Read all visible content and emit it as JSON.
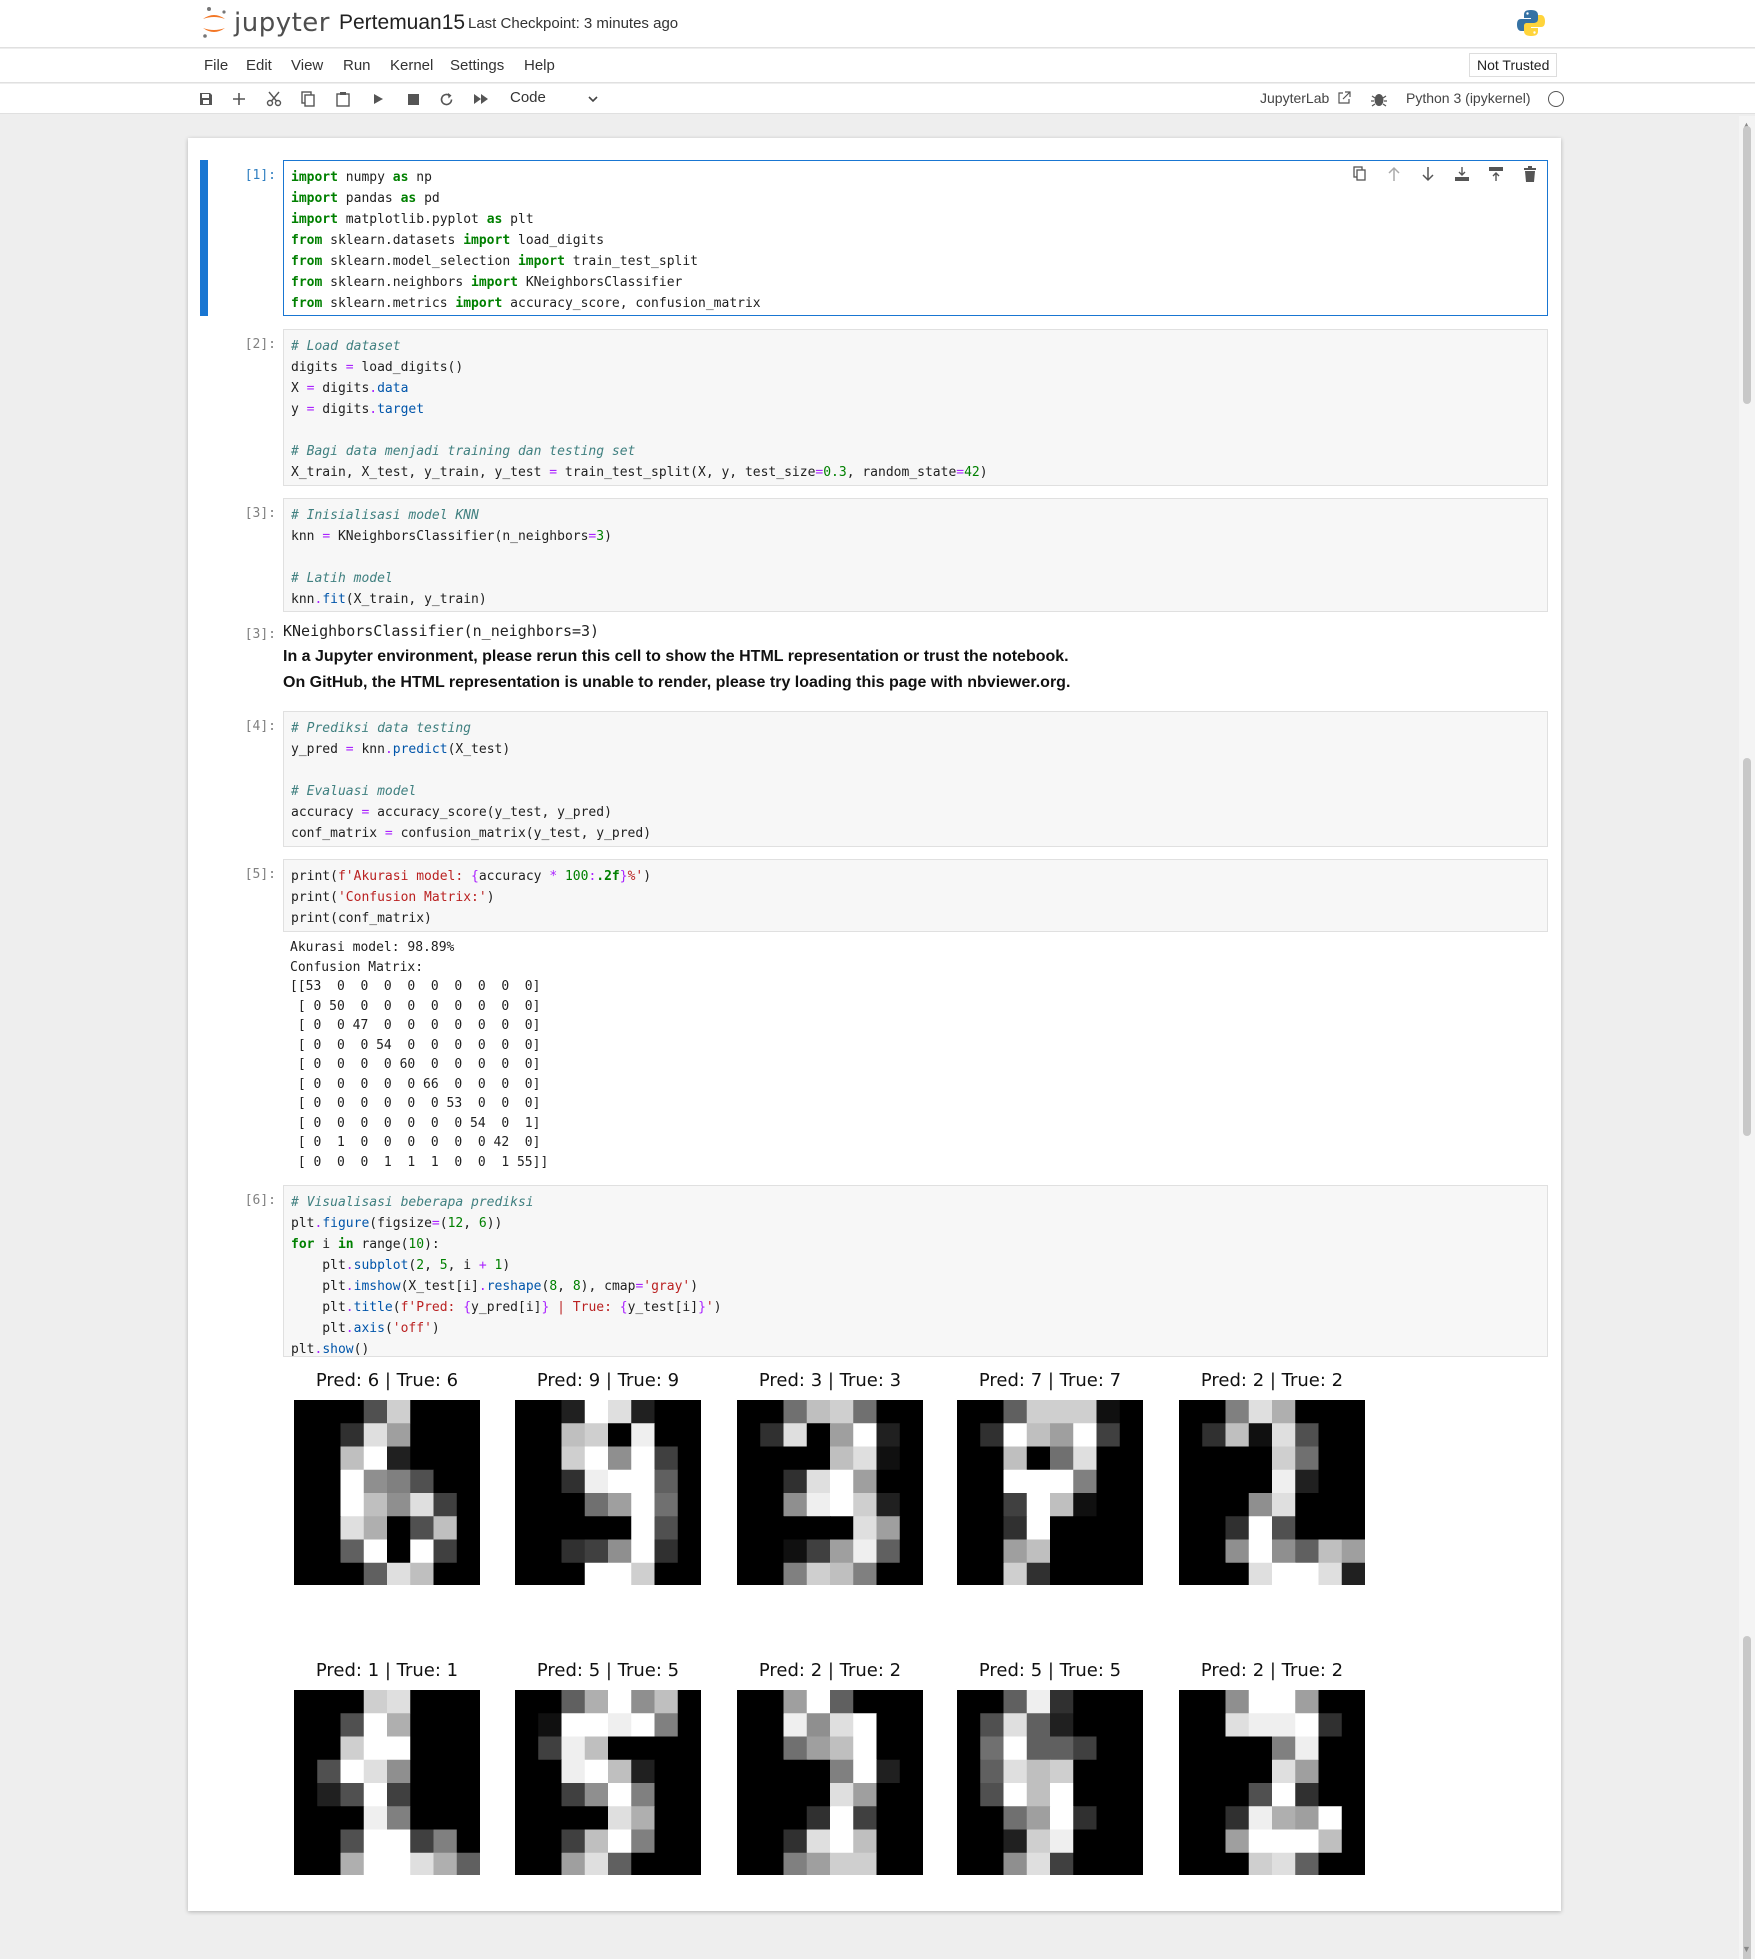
{
  "header": {
    "logo_text": "jupyter",
    "notebook_title": "Pertemuan15",
    "checkpoint": "Last Checkpoint: 3 minutes ago"
  },
  "menu": {
    "items": [
      "File",
      "Edit",
      "View",
      "Run",
      "Kernel",
      "Settings",
      "Help"
    ],
    "trust_status": "Not Trusted"
  },
  "toolbar": {
    "cell_type": "Code",
    "jupyterlab_link": "JupyterLab",
    "kernel": "Python 3 (ipykernel)",
    "icons": [
      "save-icon",
      "add-cell-icon",
      "cut-icon",
      "copy-icon",
      "paste-icon",
      "run-icon",
      "stop-icon",
      "restart-icon",
      "run-all-icon"
    ]
  },
  "cells": [
    {
      "prompt": "[1]:",
      "lines": [
        "import numpy as np",
        "import pandas as pd",
        "import matplotlib.pyplot as plt",
        "from sklearn.datasets import load_digits",
        "from sklearn.model_selection import train_test_split",
        "from sklearn.neighbors import KNeighborsClassifier",
        "from sklearn.metrics import accuracy_score, confusion_matrix"
      ]
    },
    {
      "prompt": "[2]:",
      "lines": [
        "# Load dataset",
        "digits = load_digits()",
        "X = digits.data",
        "y = digits.target",
        "",
        "# Bagi data menjadi training dan testing set",
        "X_train, X_test, y_train, y_test = train_test_split(X, y, test_size=0.3, random_state=42)"
      ]
    },
    {
      "prompt": "[3]:",
      "lines": [
        "# Inisialisasi model KNN",
        "knn = KNeighborsClassifier(n_neighbors=3)",
        "",
        "# Latih model",
        "knn.fit(X_train, y_train)"
      ]
    },
    {
      "prompt": "[4]:",
      "lines": [
        "# Prediksi data testing",
        "y_pred = knn.predict(X_test)",
        "",
        "# Evaluasi model",
        "accuracy = accuracy_score(y_test, y_pred)",
        "conf_matrix = confusion_matrix(y_test, y_pred)"
      ]
    },
    {
      "prompt": "[5]:",
      "lines": [
        "print(f'Akurasi model: {accuracy * 100:.2f}%')",
        "print('Confusion Matrix:')",
        "print(conf_matrix)"
      ]
    },
    {
      "prompt": "[6]:",
      "lines": [
        "# Visualisasi beberapa prediksi",
        "plt.figure(figsize=(12, 6))",
        "for i in range(10):",
        "    plt.subplot(2, 5, i + 1)",
        "    plt.imshow(X_test[i].reshape(8, 8), cmap='gray')",
        "    plt.title(f'Pred: {y_pred[i]} | True: {y_test[i]}')",
        "    plt.axis('off')",
        "plt.show()"
      ]
    }
  ],
  "outputs": {
    "out3_prompt": "[3]:",
    "out3_repr": "KNeighborsClassifier(n_neighbors=3)",
    "out3_msg1": "In a Jupyter environment, please rerun this cell to show the HTML representation or trust the notebook.",
    "out3_msg2": "On GitHub, the HTML representation is unable to render, please try loading this page with nbviewer.org.",
    "out5_lines": [
      "Akurasi model: 98.89%",
      "Confusion Matrix:",
      "[[53  0  0  0  0  0  0  0  0  0]",
      " [ 0 50  0  0  0  0  0  0  0  0]",
      " [ 0  0 47  0  0  0  0  0  0  0]",
      " [ 0  0  0 54  0  0  0  0  0  0]",
      " [ 0  0  0  0 60  0  0  0  0  0]",
      " [ 0  0  0  0  0 66  0  0  0  0]",
      " [ 0  0  0  0  0  0 53  0  0  0]",
      " [ 0  0  0  0  0  0  0 54  0  1]",
      " [ 0  1  0  0  0  0  0  0 42  0]",
      " [ 0  0  0  1  1  1  0  0  1 55]]"
    ]
  },
  "digit_plots": [
    {
      "title": "Pred: 6 | True: 6",
      "pixels": [
        0,
        0,
        0,
        5,
        13,
        0,
        0,
        0,
        0,
        0,
        3,
        14,
        10,
        0,
        0,
        0,
        0,
        0,
        12,
        16,
        2,
        0,
        0,
        0,
        0,
        0,
        16,
        9,
        8,
        5,
        0,
        0,
        0,
        0,
        16,
        12,
        9,
        14,
        4,
        0,
        0,
        0,
        14,
        11,
        0,
        5,
        12,
        0,
        0,
        0,
        6,
        16,
        0,
        16,
        4,
        0,
        0,
        0,
        0,
        6,
        14,
        12,
        0,
        0
      ]
    },
    {
      "title": "Pred: 9 | True: 9",
      "pixels": [
        0,
        0,
        2,
        16,
        14,
        2,
        0,
        0,
        0,
        0,
        12,
        13,
        0,
        15,
        0,
        0,
        0,
        0,
        13,
        16,
        9,
        16,
        4,
        0,
        0,
        0,
        3,
        15,
        16,
        16,
        6,
        0,
        0,
        0,
        0,
        7,
        10,
        16,
        7,
        0,
        0,
        0,
        0,
        0,
        0,
        16,
        5,
        0,
        0,
        0,
        3,
        4,
        9,
        16,
        3,
        0,
        0,
        0,
        0,
        16,
        16,
        13,
        0,
        0
      ]
    },
    {
      "title": "Pred: 3 | True: 3",
      "pixels": [
        0,
        0,
        7,
        12,
        13,
        7,
        0,
        0,
        0,
        3,
        14,
        0,
        10,
        16,
        2,
        0,
        0,
        0,
        0,
        0,
        12,
        14,
        1,
        0,
        0,
        0,
        3,
        14,
        16,
        10,
        0,
        0,
        0,
        0,
        9,
        15,
        16,
        13,
        2,
        0,
        0,
        0,
        0,
        0,
        0,
        14,
        10,
        0,
        0,
        0,
        1,
        4,
        10,
        15,
        6,
        0,
        0,
        0,
        8,
        13,
        12,
        8,
        0,
        0
      ]
    },
    {
      "title": "Pred: 7 | True: 7",
      "pixels": [
        0,
        0,
        6,
        13,
        13,
        13,
        1,
        0,
        0,
        3,
        16,
        12,
        10,
        16,
        4,
        0,
        0,
        0,
        12,
        0,
        7,
        14,
        0,
        0,
        0,
        0,
        16,
        16,
        16,
        8,
        0,
        0,
        0,
        0,
        4,
        16,
        12,
        1,
        0,
        0,
        0,
        0,
        3,
        16,
        0,
        0,
        0,
        0,
        0,
        0,
        10,
        12,
        0,
        0,
        0,
        0,
        0,
        0,
        13,
        3,
        0,
        0,
        0,
        0
      ]
    },
    {
      "title": "Pred: 2 | True: 2",
      "pixels": [
        0,
        0,
        8,
        14,
        11,
        0,
        0,
        0,
        0,
        3,
        12,
        1,
        14,
        5,
        0,
        0,
        0,
        0,
        0,
        0,
        13,
        7,
        0,
        0,
        0,
        0,
        0,
        0,
        15,
        2,
        0,
        0,
        0,
        0,
        0,
        9,
        14,
        0,
        0,
        0,
        0,
        0,
        3,
        16,
        5,
        0,
        0,
        0,
        0,
        0,
        9,
        16,
        9,
        6,
        12,
        10,
        0,
        0,
        0,
        14,
        16,
        16,
        14,
        2
      ]
    },
    {
      "title": "Pred: 1 | True: 1",
      "pixels": [
        0,
        0,
        0,
        13,
        14,
        0,
        0,
        0,
        0,
        0,
        5,
        16,
        11,
        0,
        0,
        0,
        0,
        0,
        13,
        16,
        16,
        0,
        0,
        0,
        0,
        5,
        16,
        14,
        9,
        0,
        0,
        0,
        0,
        2,
        5,
        16,
        4,
        0,
        0,
        0,
        0,
        0,
        0,
        15,
        8,
        0,
        0,
        0,
        0,
        0,
        5,
        16,
        16,
        4,
        8,
        0,
        0,
        0,
        11,
        16,
        16,
        14,
        11,
        6
      ]
    },
    {
      "title": "Pred: 5 | True: 5",
      "pixels": [
        0,
        0,
        6,
        11,
        16,
        9,
        12,
        0,
        0,
        1,
        16,
        16,
        15,
        16,
        8,
        0,
        0,
        4,
        15,
        12,
        0,
        0,
        0,
        0,
        0,
        0,
        15,
        16,
        12,
        2,
        0,
        0,
        0,
        0,
        4,
        9,
        16,
        8,
        0,
        0,
        0,
        0,
        0,
        0,
        14,
        11,
        0,
        0,
        0,
        0,
        4,
        12,
        16,
        8,
        0,
        0,
        0,
        0,
        10,
        14,
        6,
        0,
        0,
        0
      ]
    },
    {
      "title": "Pred: 2 | True: 2",
      "pixels": [
        0,
        0,
        10,
        16,
        6,
        0,
        0,
        0,
        0,
        0,
        15,
        9,
        14,
        16,
        0,
        0,
        0,
        0,
        7,
        10,
        12,
        16,
        0,
        0,
        0,
        0,
        0,
        0,
        8,
        16,
        2,
        0,
        0,
        0,
        0,
        0,
        14,
        10,
        0,
        0,
        0,
        0,
        0,
        3,
        16,
        4,
        0,
        0,
        0,
        0,
        3,
        14,
        16,
        12,
        0,
        0,
        0,
        0,
        8,
        10,
        13,
        13,
        0,
        0
      ]
    },
    {
      "title": "Pred: 5 | True: 5",
      "pixels": [
        0,
        0,
        6,
        15,
        3,
        0,
        0,
        0,
        0,
        5,
        14,
        6,
        2,
        0,
        0,
        0,
        0,
        7,
        16,
        6,
        6,
        4,
        0,
        0,
        0,
        6,
        14,
        12,
        13,
        0,
        0,
        0,
        0,
        5,
        16,
        12,
        16,
        0,
        0,
        0,
        0,
        0,
        7,
        10,
        16,
        3,
        0,
        0,
        0,
        0,
        2,
        13,
        15,
        0,
        0,
        0,
        0,
        0,
        9,
        14,
        4,
        0,
        0,
        0
      ]
    },
    {
      "title": "Pred: 2 | True: 2",
      "pixels": [
        0,
        0,
        9,
        16,
        16,
        10,
        0,
        0,
        0,
        0,
        14,
        15,
        15,
        16,
        3,
        0,
        0,
        0,
        0,
        0,
        8,
        15,
        0,
        0,
        0,
        0,
        0,
        0,
        14,
        10,
        0,
        0,
        0,
        0,
        0,
        5,
        16,
        3,
        0,
        0,
        0,
        0,
        3,
        15,
        11,
        10,
        16,
        0,
        0,
        0,
        10,
        16,
        16,
        16,
        12,
        0,
        0,
        0,
        0,
        13,
        14,
        6,
        0,
        0
      ]
    }
  ]
}
